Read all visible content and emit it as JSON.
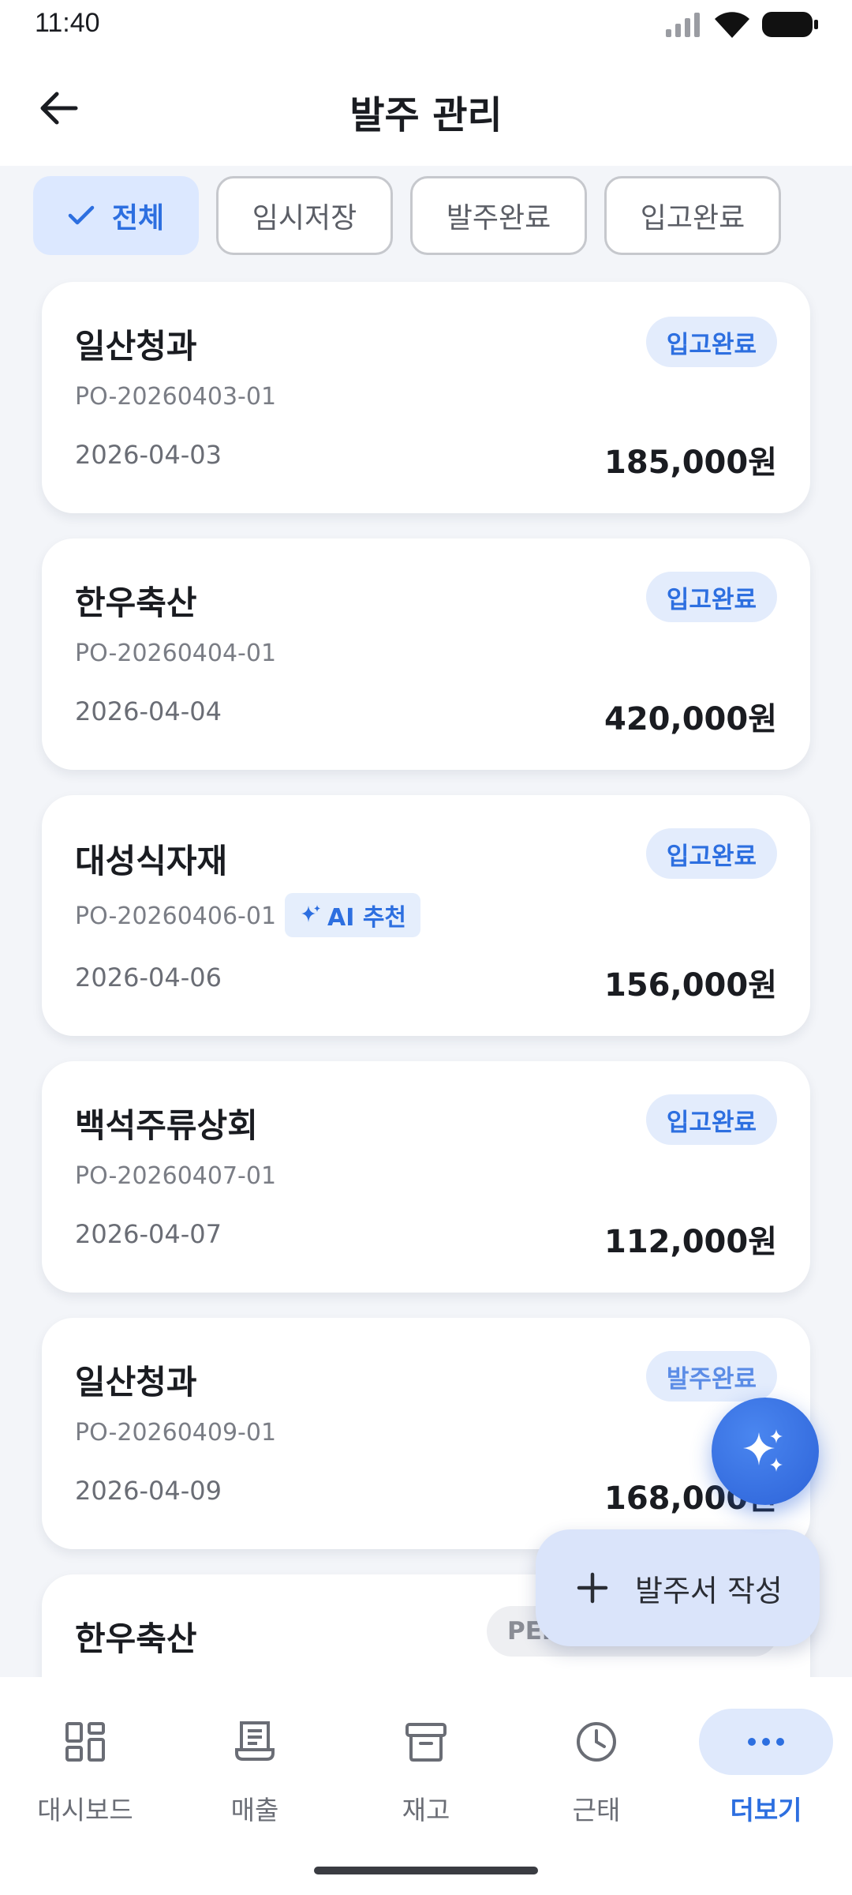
{
  "status_bar": {
    "time": "11:40"
  },
  "header": {
    "title": "발주 관리"
  },
  "filters": [
    {
      "label": "전체",
      "active": true
    },
    {
      "label": "임시저장",
      "active": false
    },
    {
      "label": "발주완료",
      "active": false
    },
    {
      "label": "입고완료",
      "active": false
    }
  ],
  "orders": [
    {
      "vendor": "일산청과",
      "po": "PO-20260403-01",
      "date": "2026-04-03",
      "amount": "185,000원",
      "status": "입고완료"
    },
    {
      "vendor": "한우축산",
      "po": "PO-20260404-01",
      "date": "2026-04-04",
      "amount": "420,000원",
      "status": "입고완료"
    },
    {
      "vendor": "대성식자재",
      "po": "PO-20260406-01",
      "date": "2026-04-06",
      "amount": "156,000원",
      "status": "입고완료",
      "tag": "AI 추천"
    },
    {
      "vendor": "백석주류상회",
      "po": "PO-20260407-01",
      "date": "2026-04-07",
      "amount": "112,000원",
      "status": "입고완료"
    },
    {
      "vendor": "일산청과",
      "po": "PO-20260409-01",
      "date": "2026-04-09",
      "amount": "168,000원",
      "status": "발주완료"
    },
    {
      "vendor": "한우축산",
      "status": "PENDING"
    }
  ],
  "fab": {
    "create_label": "발주서 작성"
  },
  "bottom_nav": [
    {
      "label": "대시보드",
      "icon": "dashboard-icon",
      "active": false
    },
    {
      "label": "매출",
      "icon": "receipt-icon",
      "active": false
    },
    {
      "label": "재고",
      "icon": "archive-box-icon",
      "active": false
    },
    {
      "label": "근태",
      "icon": "clock-icon",
      "active": false
    },
    {
      "label": "더보기",
      "icon": "more-dots-icon",
      "active": true
    }
  ],
  "colors": {
    "accent": "#2d6fe0",
    "chip_active_bg": "#dce8ff",
    "badge_bg": "#e3ecfc",
    "background": "#f3f5f9"
  }
}
